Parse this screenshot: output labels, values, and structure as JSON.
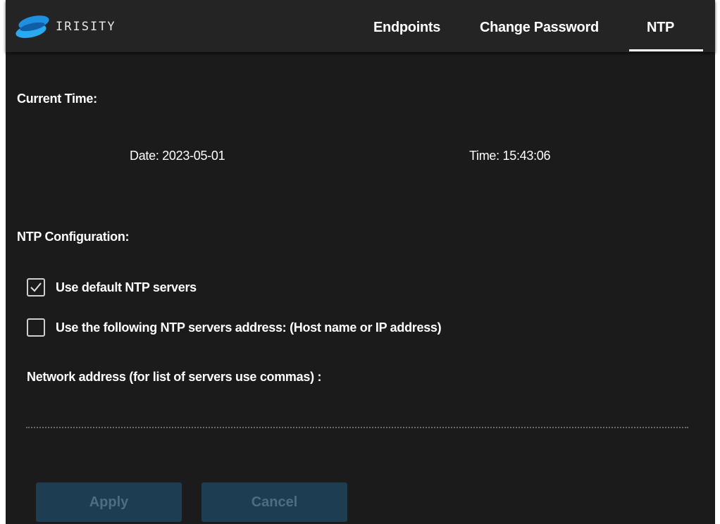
{
  "header": {
    "brand": "IRISITY",
    "logo_icon": "irisity-logo-icon",
    "tabs": [
      {
        "label": "Endpoints",
        "active": false
      },
      {
        "label": "Change Password",
        "active": false
      },
      {
        "label": "NTP",
        "active": true
      }
    ]
  },
  "current_time": {
    "heading": "Current Time:",
    "date_text": "Date: 2023-05-01",
    "time_text": "Time: 15:43:06"
  },
  "ntp_config": {
    "heading": "NTP Configuration:",
    "options": [
      {
        "label": "Use default NTP servers",
        "checked": true
      },
      {
        "label": "Use the following NTP servers address: (Host name or IP address)",
        "checked": false
      }
    ],
    "network_address_label": "Network address (for list of servers use commas) :",
    "network_address_value": ""
  },
  "buttons": {
    "apply": "Apply",
    "cancel": "Cancel"
  },
  "colors": {
    "background": "#1b1b1b",
    "topbar": "#242424",
    "button_bg": "#1c3d52",
    "button_text": "#4f6d80",
    "logo_blue": "#1e90e0"
  }
}
